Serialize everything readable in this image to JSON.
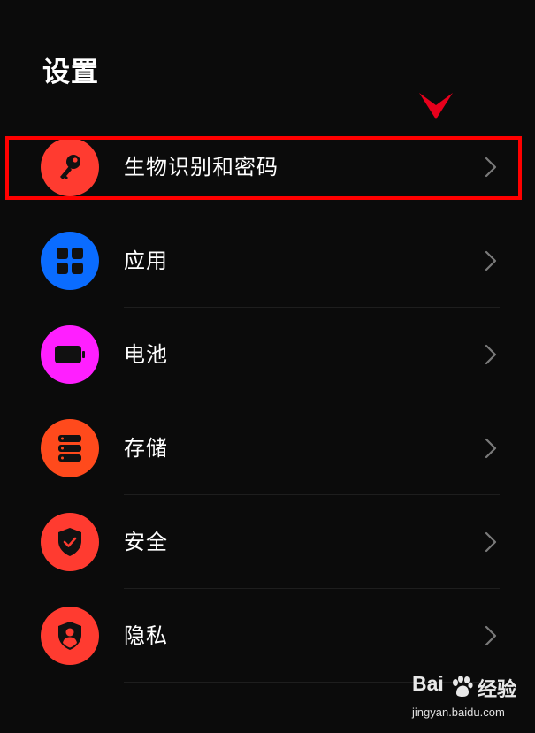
{
  "page": {
    "title": "设置"
  },
  "settings_items": [
    {
      "label": "生物识别和密码",
      "icon": "key-icon",
      "color": "#ff3b30"
    },
    {
      "label": "应用",
      "icon": "apps-grid-icon",
      "color": "#0a6cff"
    },
    {
      "label": "电池",
      "icon": "battery-icon",
      "color": "#ff1fff"
    },
    {
      "label": "存储",
      "icon": "storage-icon",
      "color": "#ff4a1c"
    },
    {
      "label": "安全",
      "icon": "shield-check-icon",
      "color": "#ff3b30"
    },
    {
      "label": "隐私",
      "icon": "privacy-shield-icon",
      "color": "#ff3b30"
    }
  ],
  "annotation": {
    "highlight_color": "#ff0000",
    "marker_color": "#e8001c"
  },
  "watermark": {
    "brand": "Bai",
    "brand_cn": "经验",
    "url": "jingyan.baidu.com"
  }
}
